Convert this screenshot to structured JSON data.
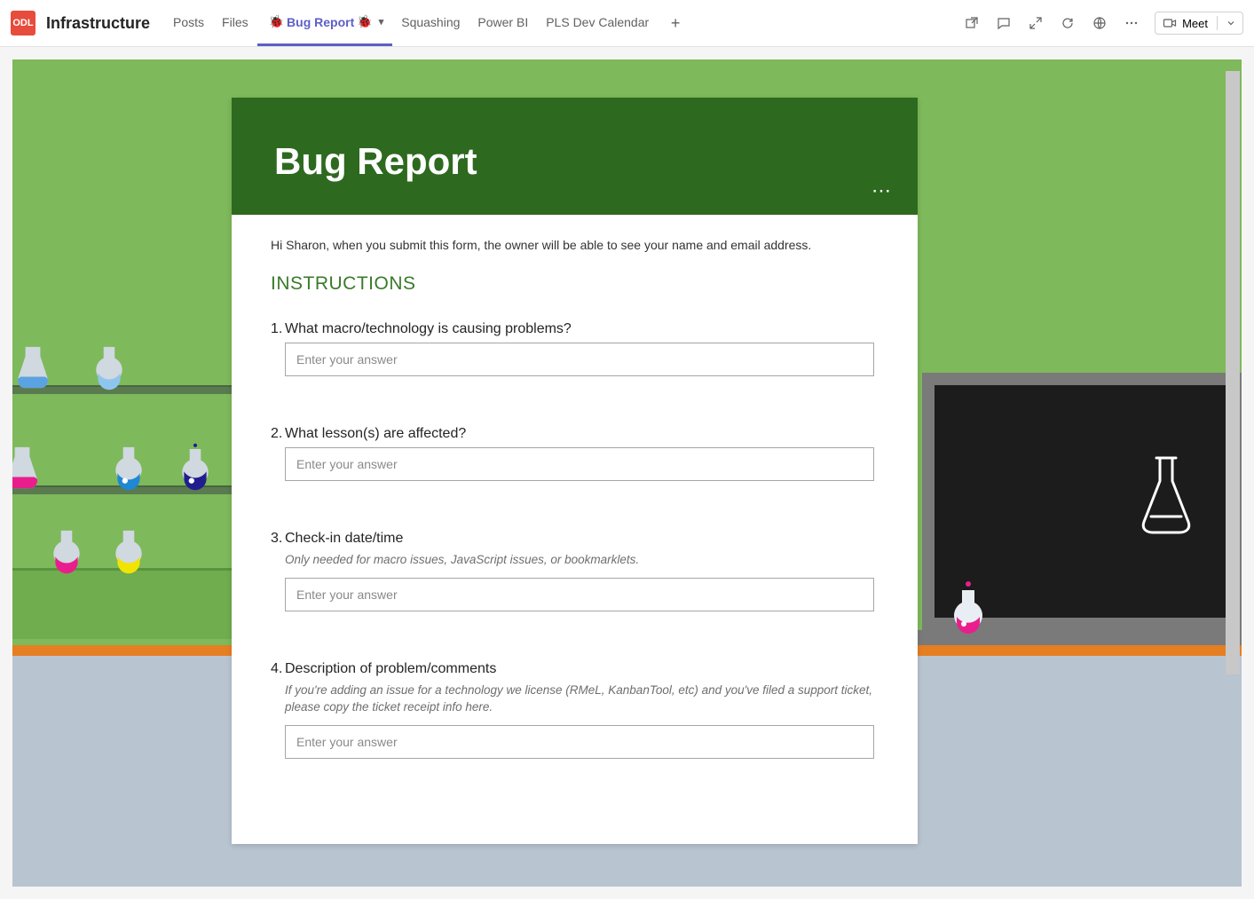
{
  "team": {
    "icon": "ODL",
    "name": "Infrastructure"
  },
  "tabs": {
    "items": [
      {
        "label": "Posts"
      },
      {
        "label": "Files"
      },
      {
        "label": "Bug Report",
        "active": true,
        "hasBugIcons": true,
        "hasChevron": true
      },
      {
        "label": "Squashing"
      },
      {
        "label": "Power BI"
      },
      {
        "label": "PLS Dev Calendar"
      }
    ]
  },
  "meet": {
    "label": "Meet"
  },
  "form": {
    "title": "Bug Report",
    "privacy": "Hi Sharon, when you submit this form, the owner will be able to see your name and email address.",
    "section": "INSTRUCTIONS",
    "placeholder": "Enter your answer",
    "questions": [
      {
        "num": "1.",
        "text": "What macro/technology is causing problems?",
        "hint": ""
      },
      {
        "num": "2.",
        "text": "What lesson(s) are affected?",
        "hint": ""
      },
      {
        "num": "3.",
        "text": "Check-in date/time",
        "hint": "Only needed for macro issues, JavaScript issues, or bookmarklets."
      },
      {
        "num": "4.",
        "text": "Description of problem/comments",
        "hint": "If you're adding an issue for a technology we license (RMeL, KanbanTool, etc) and you've filed a support ticket, please copy the ticket receipt info here."
      }
    ]
  }
}
